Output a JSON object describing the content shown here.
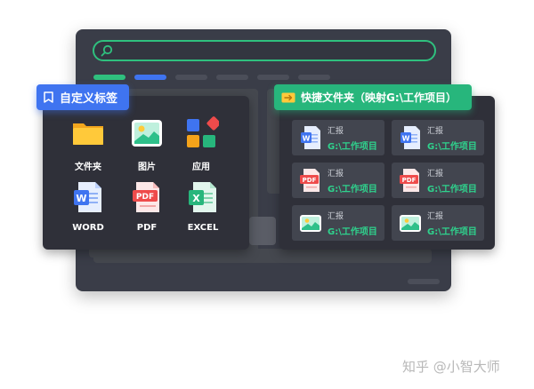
{
  "search": {
    "value": ""
  },
  "bookmarks": {
    "title": "自定义标签",
    "items": [
      {
        "label": "文件夹",
        "icon": "folder-icon"
      },
      {
        "label": "图片",
        "icon": "image-icon"
      },
      {
        "label": "应用",
        "icon": "apps-icon"
      },
      {
        "label": "WORD",
        "icon": "word-icon"
      },
      {
        "label": "PDF",
        "icon": "pdf-icon"
      },
      {
        "label": "EXCEL",
        "icon": "excel-icon"
      }
    ]
  },
  "quick_folder": {
    "title": "快捷文件夹（映射G:\\工作项目）",
    "files": [
      {
        "name": "汇报",
        "path": "G:\\工作项目",
        "icon": "word-icon"
      },
      {
        "name": "汇报",
        "path": "G:\\工作项目",
        "icon": "word-icon"
      },
      {
        "name": "汇报",
        "path": "G:\\工作项目",
        "icon": "pdf-icon"
      },
      {
        "name": "汇报",
        "path": "G:\\工作项目",
        "icon": "pdf-icon"
      },
      {
        "name": "汇报",
        "path": "G:\\工作项目",
        "icon": "image-icon"
      },
      {
        "name": "汇报",
        "path": "G:\\工作项目",
        "icon": "image-icon"
      }
    ]
  },
  "icon_text": {
    "word": "W",
    "pdf": "PDF",
    "excel": "X"
  },
  "watermark": "知乎 @小智大师",
  "colors": {
    "window_bg": "#3a3d48",
    "card_bg": "#2f3039",
    "accent_blue": "#3f74f0",
    "accent_green": "#27b67c",
    "path_green": "#2fd28d"
  }
}
